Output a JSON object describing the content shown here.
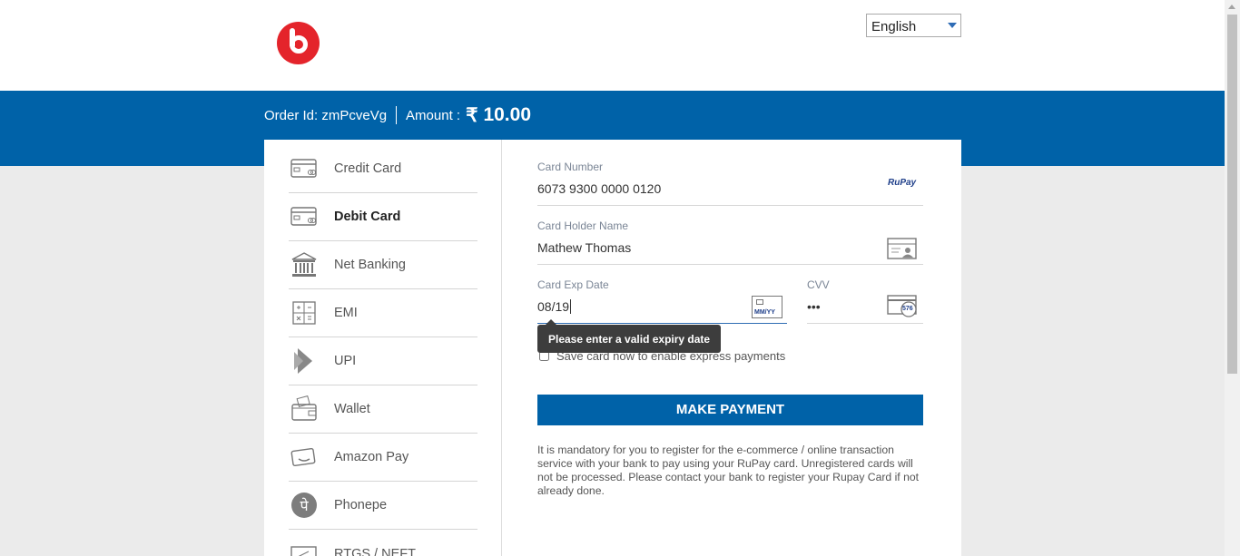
{
  "header": {
    "logo_icon": "beats-logo-icon",
    "language": "English"
  },
  "order": {
    "order_id_text": "Order Id: zmPcveVg",
    "amount_label": "Amount :",
    "currency": "₹",
    "amount": "10.00"
  },
  "sidebar": {
    "items": [
      {
        "label": "Credit Card",
        "icon": "credit-card-icon"
      },
      {
        "label": "Debit Card",
        "icon": "debit-card-icon"
      },
      {
        "label": "Net Banking",
        "icon": "bank-icon"
      },
      {
        "label": "EMI",
        "icon": "calculator-icon"
      },
      {
        "label": "UPI",
        "icon": "upi-icon"
      },
      {
        "label": "Wallet",
        "icon": "wallet-icon"
      },
      {
        "label": "Amazon Pay",
        "icon": "amazon-pay-icon"
      },
      {
        "label": "Phonepe",
        "icon": "phonepe-icon"
      },
      {
        "label": "RTGS / NEFT",
        "icon": "rtgs-icon"
      }
    ],
    "active_index": 1
  },
  "form": {
    "card_number_label": "Card Number",
    "card_number_value": "6073 9300 0000 0120",
    "card_brand": "RuPay",
    "holder_label": "Card Holder Name",
    "holder_value": "Mathew Thomas",
    "exp_label": "Card Exp Date",
    "exp_value": "08/19",
    "exp_icon_text": "MM/YY",
    "cvv_label": "CVV",
    "cvv_value": "•••",
    "cvv_icon_text": "576",
    "tooltip": "Please enter a valid expiry date",
    "save_card_label": "Save card now to enable express payments",
    "pay_button": "MAKE PAYMENT",
    "notice": "It is mandatory for you to register for the e-commerce / online transaction service with your bank to pay using your RuPay card. Unregistered cards will not be processed. Please contact your bank to register your Rupay Card if not already done."
  },
  "colors": {
    "brand_blue": "#0062a8",
    "logo_red": "#e4242b"
  }
}
